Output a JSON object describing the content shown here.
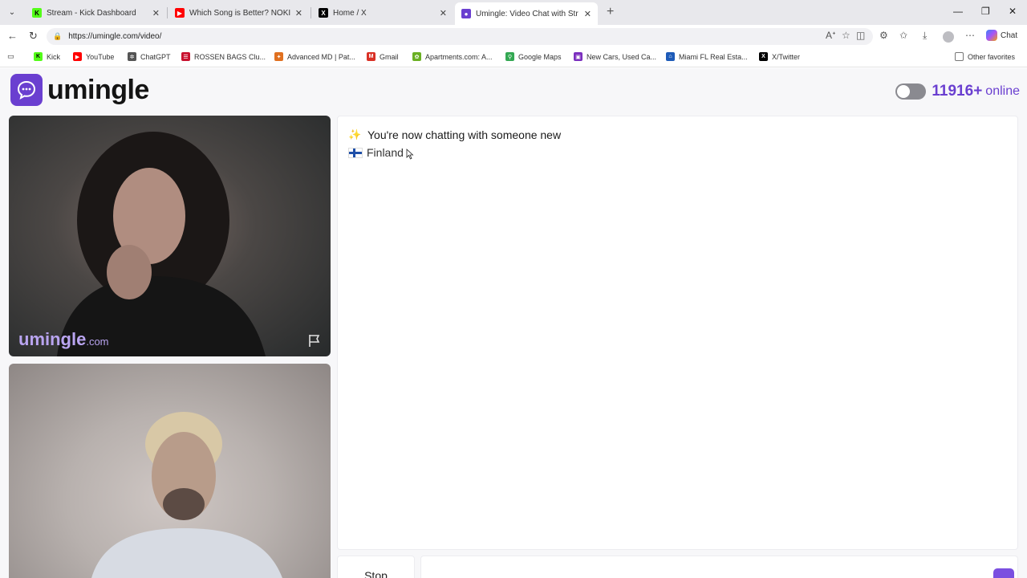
{
  "browser": {
    "tabs": [
      {
        "title": "Stream - Kick Dashboard",
        "favicon": "kick-icon",
        "color": "#53fc18",
        "glyph": "K"
      },
      {
        "title": "Which Song is Better? NOKIA vs. I",
        "favicon": "youtube-icon",
        "color": "#ff0000",
        "glyph": "▶"
      },
      {
        "title": "Home / X",
        "favicon": "x-icon",
        "color": "#000000",
        "glyph": "X"
      },
      {
        "title": "Umingle: Video Chat with Str",
        "favicon": "umingle-icon",
        "color": "#6a3fd0",
        "glyph": "●"
      }
    ],
    "url": "https://umingle.com/video/",
    "chat_label": "Chat",
    "bookmarks": [
      {
        "label": "Kick",
        "icon": "kick-icon",
        "color": "#53fc18",
        "glyph": "K"
      },
      {
        "label": "YouTube",
        "icon": "youtube-icon",
        "color": "#ff0000",
        "glyph": "▶"
      },
      {
        "label": "ChatGPT",
        "icon": "chatgpt-icon",
        "color": "#555555",
        "glyph": "✲"
      },
      {
        "label": "ROSSEN BAGS Clu...",
        "icon": "rossen-icon",
        "color": "#c8102e",
        "glyph": "☰"
      },
      {
        "label": "Advanced MD | Pat...",
        "icon": "advancedmd-icon",
        "color": "#e07020",
        "glyph": "✦"
      },
      {
        "label": "Gmail",
        "icon": "gmail-icon",
        "color": "#d93025",
        "glyph": "M"
      },
      {
        "label": "Apartments.com: A...",
        "icon": "apartments-icon",
        "color": "#6ab023",
        "glyph": "✿"
      },
      {
        "label": "Google Maps",
        "icon": "maps-icon",
        "color": "#34a853",
        "glyph": "⚲"
      },
      {
        "label": "New Cars, Used Ca...",
        "icon": "cars-icon",
        "color": "#7b2fbe",
        "glyph": "▣"
      },
      {
        "label": "Miami FL Real Esta...",
        "icon": "realestate-icon",
        "color": "#1e5bb8",
        "glyph": "⌂"
      },
      {
        "label": "X/Twitter",
        "icon": "x-icon",
        "color": "#000000",
        "glyph": "X"
      }
    ],
    "other_favorites": "Other favorites"
  },
  "site": {
    "logo_text": "umingle",
    "online_count": "11916+",
    "online_label": "online",
    "watermark": "umingle",
    "watermark_suffix": ".com"
  },
  "chat": {
    "system_message": "You're now chatting with someone new",
    "system_emoji": "✨",
    "country": "Finland",
    "stop_label": "Stop"
  }
}
